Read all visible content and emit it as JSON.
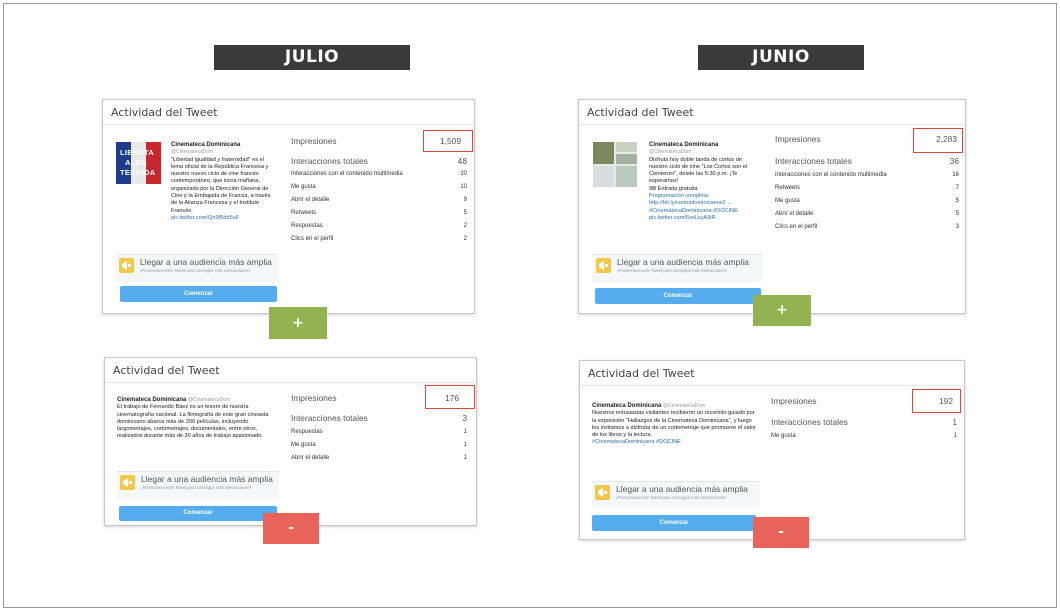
{
  "months": {
    "julio": "JULIO",
    "junio": "JUNIO"
  },
  "colors": {
    "plus": "#93b352",
    "minus": "#e8645a",
    "highlight": "#e0473a",
    "promote_button": "#55acee"
  },
  "cards": {
    "julio_top": {
      "title": "Actividad del Tweet",
      "thumb_text": [
        "LIBERTA",
        "ALDA",
        "TERNIDA"
      ],
      "tweet_name": "Cinemateca Dominicana",
      "tweet_handle": "@CinematecaDom",
      "tweet_body": "\"Libertad igualdad y fraternidad\" es el lema oficial de la República Francesa y nuestro nuevo ciclo de cine francés contemporáneo, que inicia mañana, organizado por la Dirección General de Cine y la Embajada de Francia, a través de la Alianza Francesa y el Instituto Francés.",
      "tweet_link": "pic.twitter.com/Qn9f5dd5uF",
      "stats": [
        {
          "label": "Impresiones",
          "value": "1,509"
        },
        {
          "label": "Interacciones totales",
          "value": "48"
        },
        {
          "label": "Interacciones con el contenido multimedia",
          "value": "20"
        },
        {
          "label": "Me gusta",
          "value": "10"
        },
        {
          "label": "Abrir el detalle",
          "value": "9"
        },
        {
          "label": "Retweets",
          "value": "5"
        },
        {
          "label": "Respuestas",
          "value": "2"
        },
        {
          "label": "Clics en el perfil",
          "value": "2"
        }
      ],
      "promo_title": "Llegar a una audiencia más amplia",
      "promo_sub": "¡Promociona este Tweet para conseguir más interacciones!",
      "promo_button": "Comenzar",
      "toggle": "+"
    },
    "junio_top": {
      "title": "Actividad del Tweet",
      "tweet_name": "Cinemateca Dominicana",
      "tweet_handle": "@CinematecaDom",
      "tweet_body": "Disfruta hoy doble tanda de cortos de nuestro ciclo de cine \"Los Cortos son el Comienzo\", desde las 5:30 p.m. ¡Te esperamos!",
      "tweet_extra": "🎟 Entrada gratuita",
      "tweet_program": "Programación completa: http://bit.ly/cortosdominicanos2 ...",
      "tweet_hashtags": "#CinematecaDominicana #DOCINE",
      "tweet_link": "pic.twitter.com/6xxLsyA9iR",
      "stats": [
        {
          "label": "Impresiones",
          "value": "2,283"
        },
        {
          "label": "Interacciones totales",
          "value": "36"
        },
        {
          "label": "Interacciones con el contenido multimedia",
          "value": "16"
        },
        {
          "label": "Retweets",
          "value": "7"
        },
        {
          "label": "Me gusta",
          "value": "5"
        },
        {
          "label": "Abrir el detalle",
          "value": "5"
        },
        {
          "label": "Clics en el perfil",
          "value": "3"
        }
      ],
      "promo_title": "Llegar a una audiencia más amplia",
      "promo_sub": "¡Promociona este Tweet para conseguir más interacciones!",
      "promo_button": "Comenzar",
      "toggle": "+"
    },
    "julio_bottom": {
      "title": "Actividad del Tweet",
      "tweet_name": "Cinemateca Dominicana",
      "tweet_handle": "@CinematecaDom",
      "tweet_body": "El trabajo de Fernando Báez es un tesoro de nuestra cinematografía nacional. La filmografía de este gran cineasta dominicano abarca más de 200 películas, incluyendo largometrajes, cortometrajes, documentales, entre otros, realizados durante más de 30 años de trabajo apasionado.",
      "stats": [
        {
          "label": "Impresiones",
          "value": "176"
        },
        {
          "label": "Interacciones totales",
          "value": "3"
        },
        {
          "label": "Respuestas",
          "value": "1"
        },
        {
          "label": "Me gusta",
          "value": "1"
        },
        {
          "label": "Abrir el detalle",
          "value": "1"
        }
      ],
      "promo_title": "Llegar a una audiencia más amplia",
      "promo_sub": "¡Promociona este Tweet para conseguir más interacciones!",
      "promo_button": "Comenzar",
      "toggle": "-"
    },
    "junio_bottom": {
      "title": "Actividad del Tweet",
      "tweet_name": "Cinemateca Dominicana",
      "tweet_handle": "@CinematecaDom",
      "tweet_body": "Nuestros entusiastas visitantes recibieron un recorrido guiado por la exposición \"Hallazgos de la Cinemateca Dominicana\", y luego los invitamos a disfrutar de un cortometraje que promueve el valor de los libros y la lectura.",
      "tweet_hashtags": "#CinematecaDominicana #DOCINE",
      "stats": [
        {
          "label": "Impresiones",
          "value": "192"
        },
        {
          "label": "Interacciones totales",
          "value": "1"
        },
        {
          "label": "Me gusta",
          "value": "1"
        }
      ],
      "promo_title": "Llegar a una audiencia más amplia",
      "promo_sub": "¡Promociona este Tweet para conseguir más interacciones!",
      "promo_button": "Comenzar",
      "toggle": "-"
    }
  }
}
